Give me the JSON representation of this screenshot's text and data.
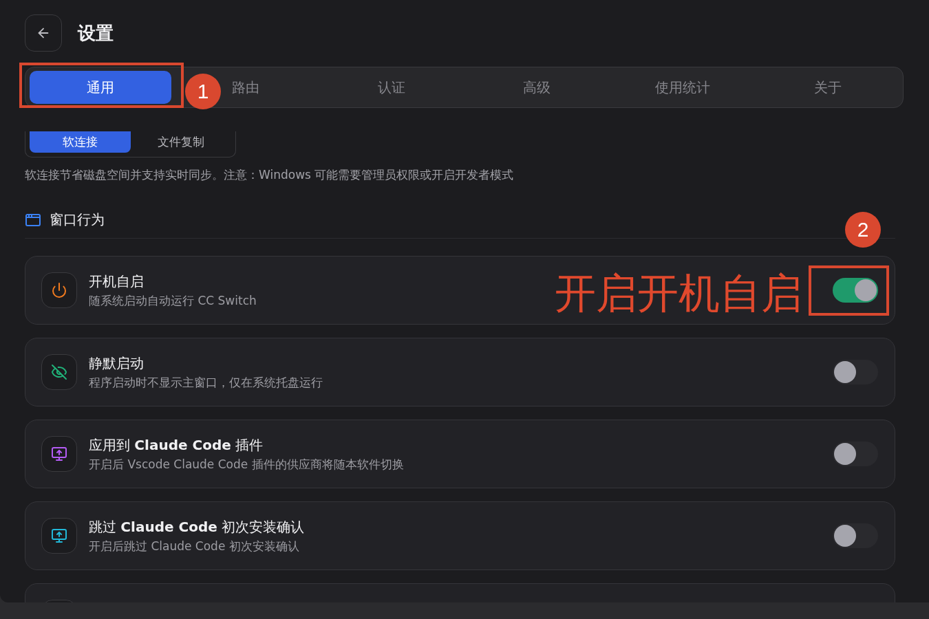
{
  "header": {
    "title": "设置"
  },
  "tabs": [
    {
      "label": "通用",
      "selected": true
    },
    {
      "label": "路由",
      "selected": false
    },
    {
      "label": "认证",
      "selected": false
    },
    {
      "label": "高级",
      "selected": false
    },
    {
      "label": "使用统计",
      "selected": false
    },
    {
      "label": "关于",
      "selected": false
    }
  ],
  "link_mode": {
    "options": [
      {
        "label": "软连接",
        "selected": true
      },
      {
        "label": "文件复制",
        "selected": false
      }
    ],
    "note": "软连接节省磁盘空间并支持实时同步。注意：Windows 可能需要管理员权限或开启开发者模式"
  },
  "section": {
    "title": "窗口行为"
  },
  "settings": [
    {
      "kind": "power",
      "title": "开机自启",
      "description": "随系统启动自动运行 CC Switch",
      "on": true
    },
    {
      "kind": "hidden",
      "title": "静默启动",
      "description": "程序启动时不显示主窗口，仅在系统托盘运行",
      "on": false
    },
    {
      "kind": "plugin",
      "title": "应用到 **Claude Code** 插件",
      "description": "开启后 Vscode Claude Code 插件的供应商将随本软件切换",
      "on": false
    },
    {
      "kind": "confirm",
      "title": "跳过 **Claude Code** 初次安装确认",
      "description": "开启后跳过 Claude Code 初次安装确认",
      "on": false
    },
    {
      "kind": "clipped"
    }
  ],
  "annotations": [
    {
      "kind": "frame"
    },
    {
      "kind": "marker",
      "label": "1"
    },
    {
      "kind": "marker",
      "label": "2"
    },
    {
      "kind": "callout",
      "text": "开启开机自启"
    },
    {
      "kind": "frame"
    }
  ]
}
